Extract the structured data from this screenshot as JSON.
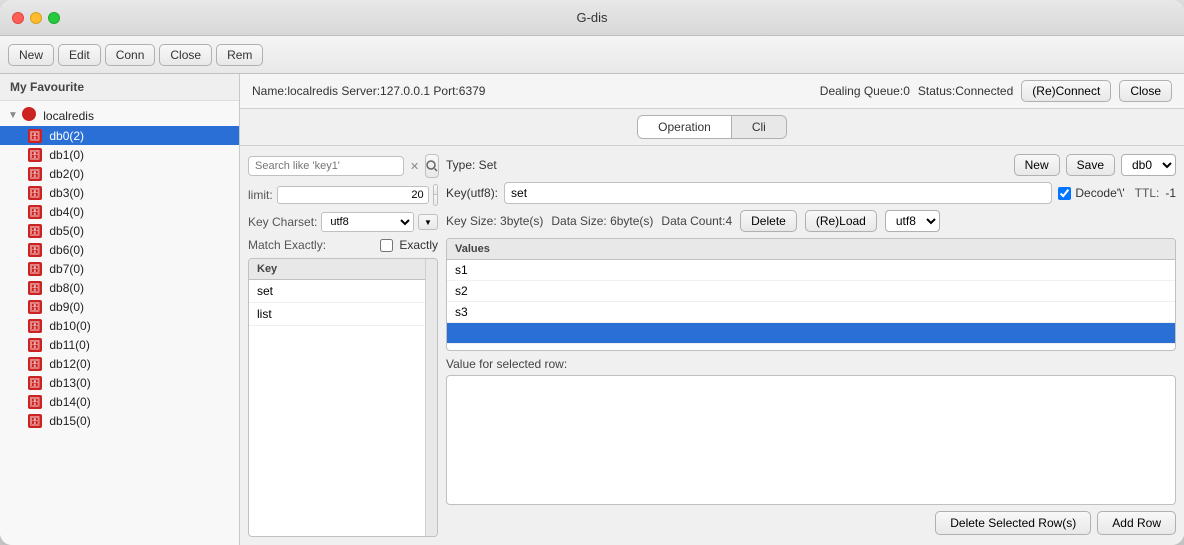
{
  "window": {
    "title": "G-dis"
  },
  "toolbar": {
    "new_label": "New",
    "edit_label": "Edit",
    "conn_label": "Conn",
    "close_label": "Close",
    "rem_label": "Rem"
  },
  "sidebar": {
    "header": "My Favourite",
    "server_name": "localredis",
    "databases": [
      {
        "label": "db0(2)",
        "selected": true
      },
      {
        "label": "db1(0)"
      },
      {
        "label": "db2(0)"
      },
      {
        "label": "db3(0)"
      },
      {
        "label": "db4(0)"
      },
      {
        "label": "db5(0)"
      },
      {
        "label": "db6(0)"
      },
      {
        "label": "db7(0)"
      },
      {
        "label": "db8(0)"
      },
      {
        "label": "db9(0)"
      },
      {
        "label": "db10(0)"
      },
      {
        "label": "db11(0)"
      },
      {
        "label": "db12(0)"
      },
      {
        "label": "db13(0)"
      },
      {
        "label": "db14(0)"
      },
      {
        "label": "db15(0)"
      }
    ]
  },
  "connection": {
    "info": "Name:localredis  Server:127.0.0.1  Port:6379",
    "queue": "Dealing Queue:0",
    "status": "Status:Connected",
    "reconnect_label": "(Re)Connect",
    "close_label": "Close"
  },
  "tabs": {
    "operation_label": "Operation",
    "cli_label": "Cli",
    "active": "Operation"
  },
  "key_list": {
    "search_placeholder": "Search like 'key1'",
    "limit_label": "limit:",
    "limit_value": "20",
    "charset_label": "Key Charset:",
    "charset_value": "utf8",
    "match_label": "Match Exactly:",
    "exactly_label": "Exactly",
    "keys": [
      {
        "label": "set",
        "selected": false
      },
      {
        "label": "list"
      }
    ],
    "key_header": "Key"
  },
  "value_panel": {
    "type_label": "Type: Set",
    "new_label": "New",
    "save_label": "Save",
    "db_value": "db0",
    "key_label": "Key(utf8):",
    "key_value": "set",
    "decode_label": "Decode'\\'",
    "decode_checked": true,
    "ttl_label": "TTL:",
    "ttl_value": "-1",
    "key_size_label": "Key Size: 3byte(s)",
    "data_size_label": "Data Size: 6byte(s)",
    "data_count_label": "Data Count:4",
    "delete_label": "Delete",
    "reload_label": "(Re)Load",
    "encoding_value": "utf8",
    "values_header": "Values",
    "values": [
      {
        "label": "s1"
      },
      {
        "label": "s2"
      },
      {
        "label": "s3"
      },
      {
        "label": "",
        "selected": true
      }
    ],
    "selected_value_label": "Value for selected row:",
    "delete_row_label": "Delete Selected Row(s)",
    "add_row_label": "Add Row"
  }
}
